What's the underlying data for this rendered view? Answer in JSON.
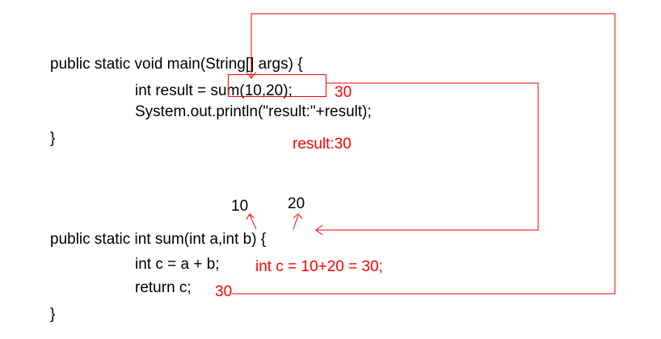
{
  "code": {
    "main_signature": "public static void main(String[] args) {",
    "main_line1_prefix": "int result = ",
    "main_line1_call": "sum(10,20)",
    "main_line1_suffix": ";",
    "main_line2": "System.out.println(\"result:\"+result);",
    "main_close": "}",
    "sum_signature": "public static int sum(int a,int b) {",
    "sum_line1": "int c = a + b;",
    "sum_line2": "return c;",
    "sum_close": "}"
  },
  "annotations": {
    "returned_value": "30",
    "printed_output": "result:30",
    "arg_a_value": "10",
    "arg_b_value": "20",
    "calc_note": "int c = 10+20 = 30;",
    "return_value": "30"
  },
  "colors": {
    "code": "#000000",
    "annotation": "#ff0000",
    "arrow": "#ff0000"
  }
}
